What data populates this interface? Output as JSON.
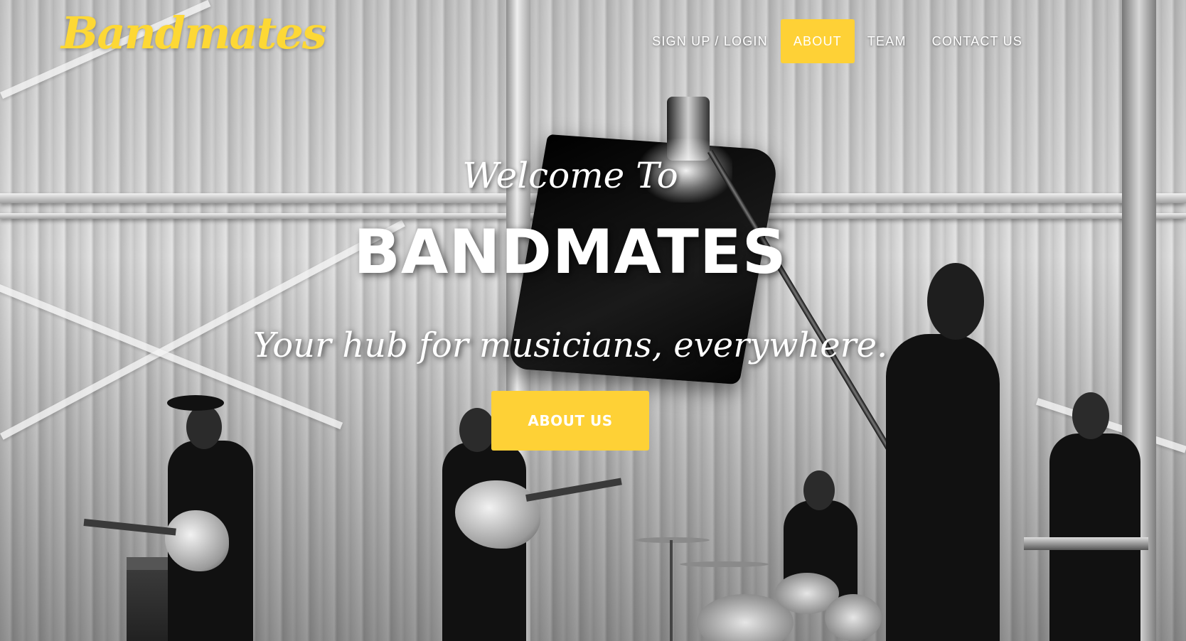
{
  "nav": {
    "logo": "Bandmates",
    "links": [
      {
        "label": "SIGN UP / LOGIN"
      },
      {
        "label": "ABOUT"
      },
      {
        "label": "TEAM"
      },
      {
        "label": "CONTACT US"
      }
    ],
    "active_link": "ABOUT"
  },
  "hero": {
    "lead_in": "Welcome To",
    "heading": "BANDMATES",
    "tagline": "Your hub for musicians, everywhere.",
    "cta_label": "ABOUT US",
    "background_description_icon": "band-photo"
  },
  "colors": {
    "accent": "#fed136",
    "logo": "#fdd835",
    "text": "#ffffff"
  }
}
